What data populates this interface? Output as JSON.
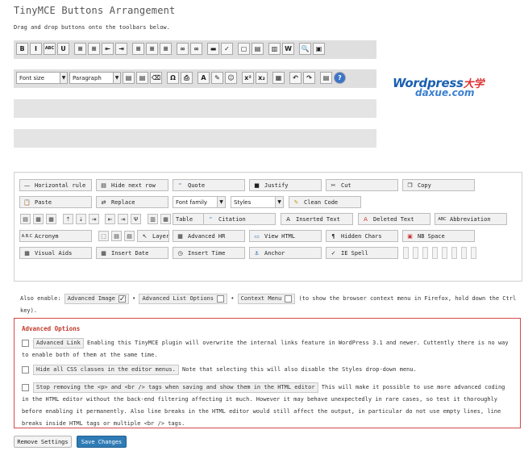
{
  "title": "TinyMCE Buttons Arrangement",
  "intro": "Drag and drop buttons onto the toolbars below.",
  "toolbar1": {
    "buttons": [
      {
        "icon": "bold-icon",
        "glyph": "B"
      },
      {
        "icon": "italic-icon",
        "glyph": "I"
      },
      {
        "icon": "strikethrough-icon",
        "glyph": "ABC"
      },
      {
        "icon": "underline-icon",
        "glyph": "U"
      },
      {
        "icon": "bullet-list-icon",
        "glyph": "≡"
      },
      {
        "icon": "numbered-list-icon",
        "glyph": "≡"
      },
      {
        "icon": "outdent-icon",
        "glyph": "⇤"
      },
      {
        "icon": "indent-icon",
        "glyph": "⇥"
      },
      {
        "icon": "align-left-icon",
        "glyph": "≡"
      },
      {
        "icon": "align-center-icon",
        "glyph": "≡"
      },
      {
        "icon": "align-right-icon",
        "glyph": "≡"
      },
      {
        "icon": "link-icon",
        "glyph": "∞"
      },
      {
        "icon": "unlink-icon",
        "glyph": "∞"
      },
      {
        "icon": "insert-more-icon",
        "glyph": "▬"
      },
      {
        "icon": "spellcheck-icon",
        "glyph": "✓"
      },
      {
        "icon": "fullscreen-icon",
        "glyph": "▢"
      },
      {
        "icon": "kitchen-sink-icon",
        "glyph": "▤"
      },
      {
        "icon": "page-break-icon",
        "glyph": "▥"
      },
      {
        "icon": "paste-word-icon",
        "glyph": "W"
      },
      {
        "icon": "find-icon",
        "glyph": "🔍"
      },
      {
        "icon": "media-icon",
        "glyph": "▣"
      }
    ]
  },
  "toolbar2": {
    "font_size": "Font size",
    "paragraph": "Paragraph",
    "buttons": [
      {
        "icon": "paste-text-icon",
        "glyph": "▤"
      },
      {
        "icon": "paste-word-icon",
        "glyph": "▤"
      },
      {
        "icon": "remove-format-icon",
        "glyph": "⌫"
      },
      {
        "icon": "special-char-icon",
        "glyph": "Ω"
      },
      {
        "icon": "print-icon",
        "glyph": "⎙"
      },
      {
        "icon": "text-color-icon",
        "glyph": "A"
      },
      {
        "icon": "highlight-icon",
        "glyph": "✎"
      },
      {
        "icon": "emoticon-icon",
        "glyph": "☺"
      },
      {
        "icon": "superscript-icon",
        "glyph": "x²"
      },
      {
        "icon": "subscript-icon",
        "glyph": "x₂"
      },
      {
        "icon": "media-icon",
        "glyph": "▦"
      },
      {
        "icon": "undo-icon",
        "glyph": "↶"
      },
      {
        "icon": "redo-icon",
        "glyph": "↷"
      },
      {
        "icon": "template-icon",
        "glyph": "▤"
      },
      {
        "icon": "help-icon",
        "glyph": "?"
      }
    ]
  },
  "logo": {
    "line1a": "Wordpress",
    "line1b": "大学",
    "line2": "daxue.com"
  },
  "pool": {
    "row1": [
      "Horizontal rule",
      "Hide next row",
      "Quote",
      "Justify",
      "Cut",
      "Copy"
    ],
    "row2": {
      "paste": "Paste",
      "replace": "Replace",
      "font_family": "Font family",
      "styles": "Styles",
      "clean_code": "Clean Code"
    },
    "row3": {
      "table": "Table",
      "citation": "Citation",
      "inserted": "Inserted Text",
      "deleted": "Deleted Text",
      "abbr": "Abbreviation"
    },
    "row4": {
      "acronym": "Acronym",
      "layer": "Layer",
      "advhr": "Advanced HR",
      "view_html": "View HTML",
      "hidden_chars": "Hidden Chars",
      "nbsp": "NB Space"
    },
    "row5": [
      "Visual Aids",
      "Insert Date",
      "Insert Time",
      "Anchor",
      "IE Spell"
    ]
  },
  "also": {
    "label": "Also enable:",
    "adv_image": "Advanced Image",
    "adv_list": "Advanced List Options",
    "context_menu": "Context Menu",
    "tail": "(to show the browser context menu in Firefox, hold down the Ctrl key)."
  },
  "advanced": {
    "title": "Advanced Options",
    "opt1_label": "Advanced Link",
    "opt1_text": "Enabling this TinyMCE plugin will overwrite the internal links feature in WordPress 3.1 and newer. Cuttently there is no way to enable both of them at the same time.",
    "opt2_label": "Hide all CSS classes in the editor menus.",
    "opt2_text": "Note that selecting this will also disable the Styles drop-down menu.",
    "opt3_label": "Stop removing the <p> and <br /> tags when saving and show them in the HTML editor",
    "opt3_text": "This will make it possible to use more advanced coding in the HTML editor without the back-end filtering affecting it much. However it may behave unexpectedly in rare cases, so test it thoroughly before enabling it permanently. Also line breaks in the HTML editor would still affect the output, in particular do not use empty lines, line breaks inside HTML tags or multiple <br /> tags."
  },
  "buttons": {
    "remove": "Remove Settings",
    "save": "Save Changes"
  }
}
